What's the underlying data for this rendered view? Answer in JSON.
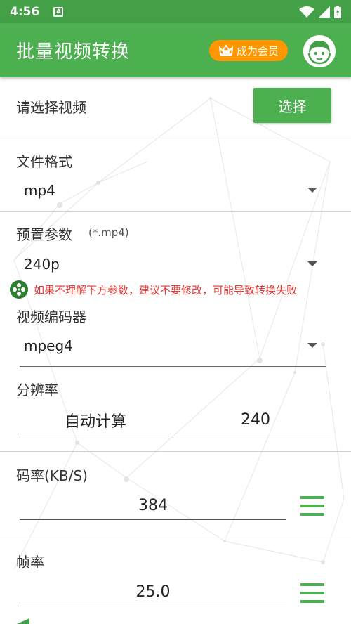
{
  "status_bar": {
    "time": "4:56",
    "notification_letter": "A",
    "icons": [
      "wifi-icon",
      "signal-icon",
      "battery-icon"
    ]
  },
  "app_bar": {
    "title": "批量视频转换",
    "vip_label": "成为会员",
    "avatar": "avatar-icon"
  },
  "select_video": {
    "label": "请选择视频",
    "button": "选择"
  },
  "file_format": {
    "label": "文件格式",
    "value": "mp4"
  },
  "preset": {
    "label": "预置参数",
    "hint": "(*.mp4)",
    "value": "240p"
  },
  "warning": "如果不理解下方参数，建议不要修改，可能导致转换失败",
  "video_encoder": {
    "label": "视频编码器",
    "value": "mpeg4"
  },
  "resolution": {
    "label": "分辨率",
    "width": "自动计算",
    "height": "240"
  },
  "bitrate": {
    "label": "码率(KB/S)",
    "value": "384"
  },
  "framerate": {
    "label": "帧率",
    "value": "25.0"
  },
  "colors": {
    "primary": "#4caf50",
    "status_bar": "#43a047",
    "vip_orange": "#ff9800",
    "warning_red": "#e53935"
  }
}
